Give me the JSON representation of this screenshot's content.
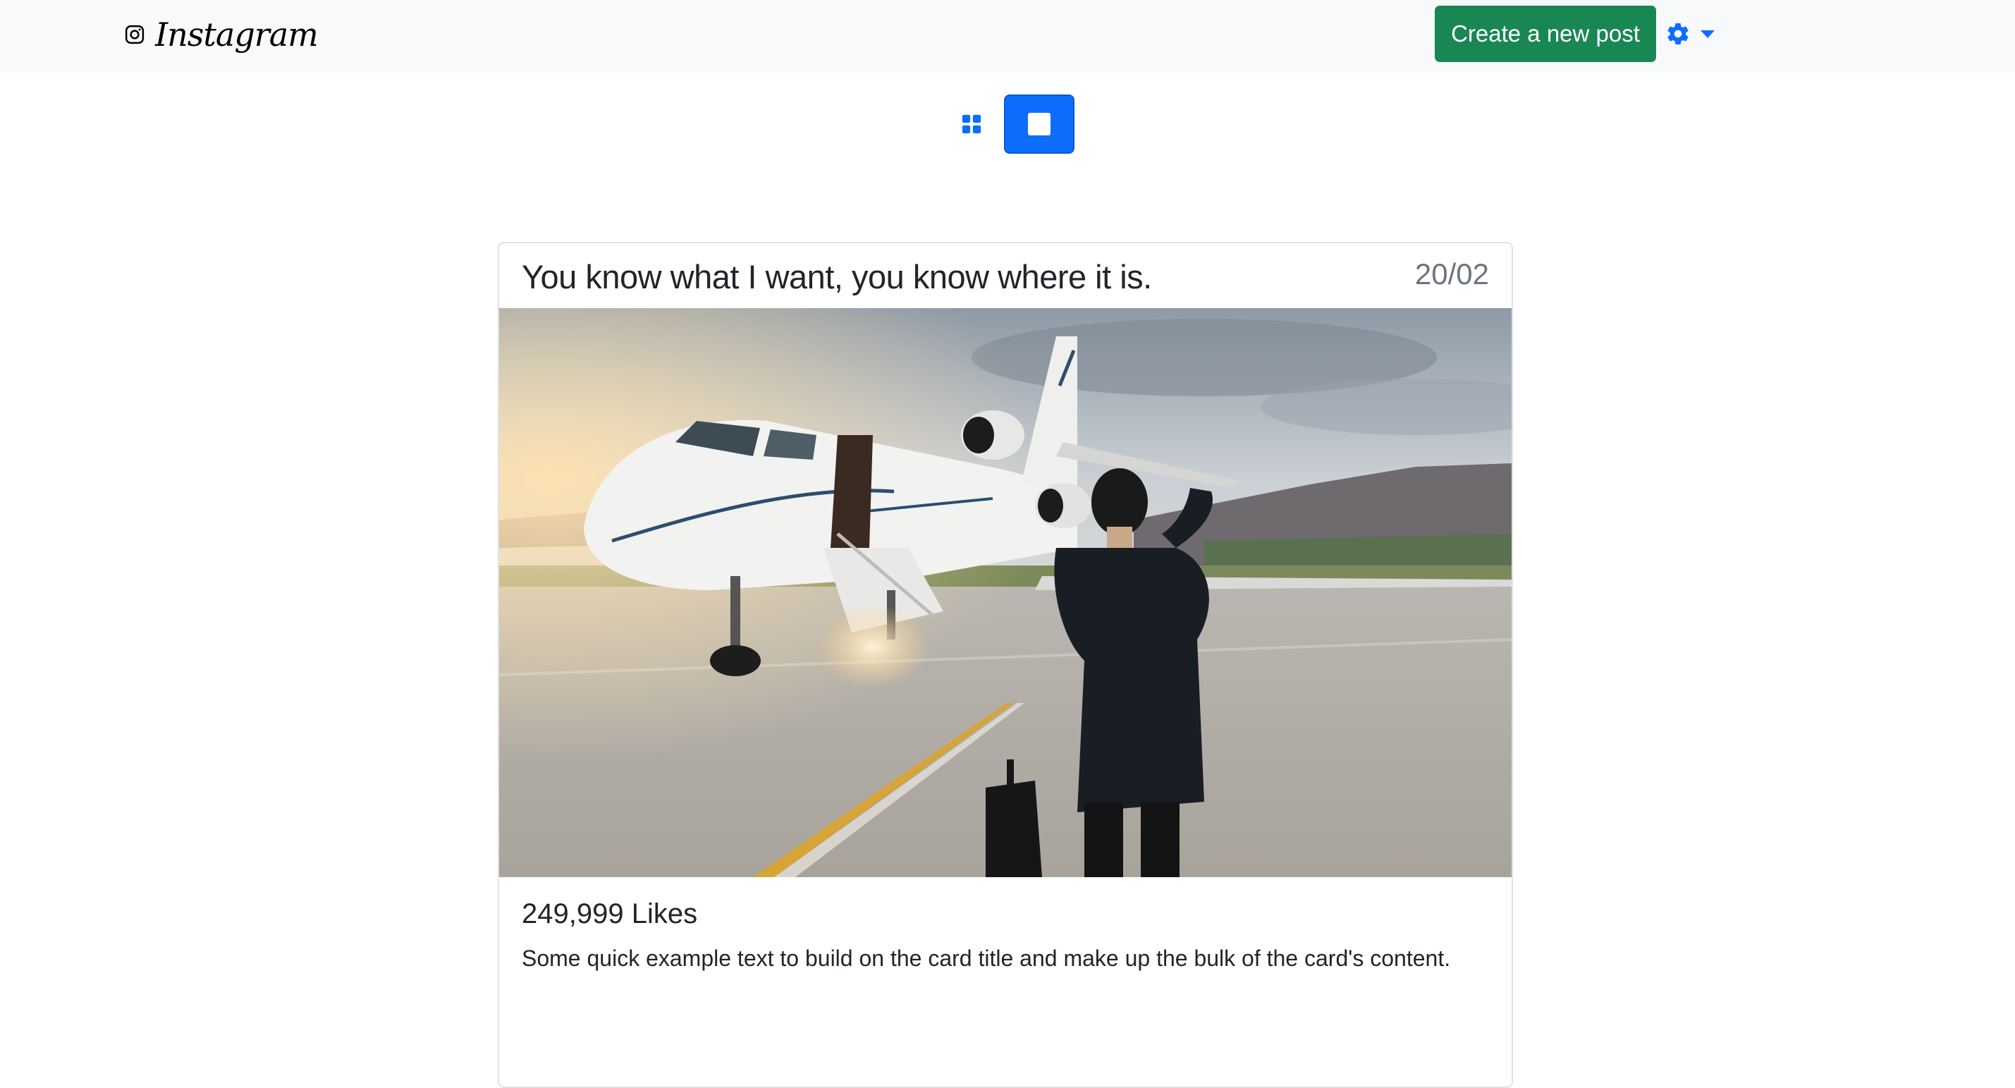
{
  "navbar": {
    "brand": "Instagram",
    "brand_icon": "instagram-icon",
    "create_button": "Create a new post",
    "settings_icon": "gear-icon",
    "dropdown_icon": "caret-down-icon",
    "accent_color": "#0d6efd",
    "create_color": "#198754"
  },
  "view_toggle": {
    "grid_icon": "grid-icon",
    "single_icon": "square-icon",
    "active": "single"
  },
  "post": {
    "title": "You know what I want, you know where it is.",
    "date": "20/02",
    "image": "businessman-walking-to-private-jet-photo",
    "likes": "249,999 Likes",
    "text": "Some quick example text to build on the card title and make up the bulk of the card's content."
  }
}
